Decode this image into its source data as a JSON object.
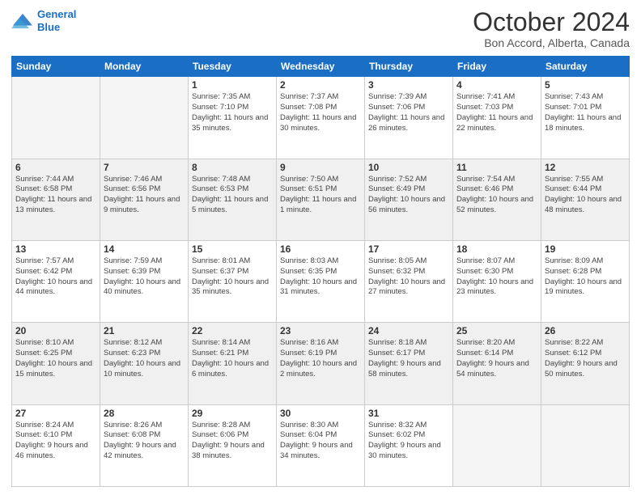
{
  "logo": {
    "line1": "General",
    "line2": "Blue"
  },
  "title": "October 2024",
  "subtitle": "Bon Accord, Alberta, Canada",
  "days_header": [
    "Sunday",
    "Monday",
    "Tuesday",
    "Wednesday",
    "Thursday",
    "Friday",
    "Saturday"
  ],
  "weeks": [
    [
      {
        "num": "",
        "info": ""
      },
      {
        "num": "",
        "info": ""
      },
      {
        "num": "1",
        "info": "Sunrise: 7:35 AM\nSunset: 7:10 PM\nDaylight: 11 hours\nand 35 minutes."
      },
      {
        "num": "2",
        "info": "Sunrise: 7:37 AM\nSunset: 7:08 PM\nDaylight: 11 hours\nand 30 minutes."
      },
      {
        "num": "3",
        "info": "Sunrise: 7:39 AM\nSunset: 7:06 PM\nDaylight: 11 hours\nand 26 minutes."
      },
      {
        "num": "4",
        "info": "Sunrise: 7:41 AM\nSunset: 7:03 PM\nDaylight: 11 hours\nand 22 minutes."
      },
      {
        "num": "5",
        "info": "Sunrise: 7:43 AM\nSunset: 7:01 PM\nDaylight: 11 hours\nand 18 minutes."
      }
    ],
    [
      {
        "num": "6",
        "info": "Sunrise: 7:44 AM\nSunset: 6:58 PM\nDaylight: 11 hours\nand 13 minutes."
      },
      {
        "num": "7",
        "info": "Sunrise: 7:46 AM\nSunset: 6:56 PM\nDaylight: 11 hours\nand 9 minutes."
      },
      {
        "num": "8",
        "info": "Sunrise: 7:48 AM\nSunset: 6:53 PM\nDaylight: 11 hours\nand 5 minutes."
      },
      {
        "num": "9",
        "info": "Sunrise: 7:50 AM\nSunset: 6:51 PM\nDaylight: 11 hours\nand 1 minute."
      },
      {
        "num": "10",
        "info": "Sunrise: 7:52 AM\nSunset: 6:49 PM\nDaylight: 10 hours\nand 56 minutes."
      },
      {
        "num": "11",
        "info": "Sunrise: 7:54 AM\nSunset: 6:46 PM\nDaylight: 10 hours\nand 52 minutes."
      },
      {
        "num": "12",
        "info": "Sunrise: 7:55 AM\nSunset: 6:44 PM\nDaylight: 10 hours\nand 48 minutes."
      }
    ],
    [
      {
        "num": "13",
        "info": "Sunrise: 7:57 AM\nSunset: 6:42 PM\nDaylight: 10 hours\nand 44 minutes."
      },
      {
        "num": "14",
        "info": "Sunrise: 7:59 AM\nSunset: 6:39 PM\nDaylight: 10 hours\nand 40 minutes."
      },
      {
        "num": "15",
        "info": "Sunrise: 8:01 AM\nSunset: 6:37 PM\nDaylight: 10 hours\nand 35 minutes."
      },
      {
        "num": "16",
        "info": "Sunrise: 8:03 AM\nSunset: 6:35 PM\nDaylight: 10 hours\nand 31 minutes."
      },
      {
        "num": "17",
        "info": "Sunrise: 8:05 AM\nSunset: 6:32 PM\nDaylight: 10 hours\nand 27 minutes."
      },
      {
        "num": "18",
        "info": "Sunrise: 8:07 AM\nSunset: 6:30 PM\nDaylight: 10 hours\nand 23 minutes."
      },
      {
        "num": "19",
        "info": "Sunrise: 8:09 AM\nSunset: 6:28 PM\nDaylight: 10 hours\nand 19 minutes."
      }
    ],
    [
      {
        "num": "20",
        "info": "Sunrise: 8:10 AM\nSunset: 6:25 PM\nDaylight: 10 hours\nand 15 minutes."
      },
      {
        "num": "21",
        "info": "Sunrise: 8:12 AM\nSunset: 6:23 PM\nDaylight: 10 hours\nand 10 minutes."
      },
      {
        "num": "22",
        "info": "Sunrise: 8:14 AM\nSunset: 6:21 PM\nDaylight: 10 hours\nand 6 minutes."
      },
      {
        "num": "23",
        "info": "Sunrise: 8:16 AM\nSunset: 6:19 PM\nDaylight: 10 hours\nand 2 minutes."
      },
      {
        "num": "24",
        "info": "Sunrise: 8:18 AM\nSunset: 6:17 PM\nDaylight: 9 hours\nand 58 minutes."
      },
      {
        "num": "25",
        "info": "Sunrise: 8:20 AM\nSunset: 6:14 PM\nDaylight: 9 hours\nand 54 minutes."
      },
      {
        "num": "26",
        "info": "Sunrise: 8:22 AM\nSunset: 6:12 PM\nDaylight: 9 hours\nand 50 minutes."
      }
    ],
    [
      {
        "num": "27",
        "info": "Sunrise: 8:24 AM\nSunset: 6:10 PM\nDaylight: 9 hours\nand 46 minutes."
      },
      {
        "num": "28",
        "info": "Sunrise: 8:26 AM\nSunset: 6:08 PM\nDaylight: 9 hours\nand 42 minutes."
      },
      {
        "num": "29",
        "info": "Sunrise: 8:28 AM\nSunset: 6:06 PM\nDaylight: 9 hours\nand 38 minutes."
      },
      {
        "num": "30",
        "info": "Sunrise: 8:30 AM\nSunset: 6:04 PM\nDaylight: 9 hours\nand 34 minutes."
      },
      {
        "num": "31",
        "info": "Sunrise: 8:32 AM\nSunset: 6:02 PM\nDaylight: 9 hours\nand 30 minutes."
      },
      {
        "num": "",
        "info": ""
      },
      {
        "num": "",
        "info": ""
      }
    ]
  ]
}
